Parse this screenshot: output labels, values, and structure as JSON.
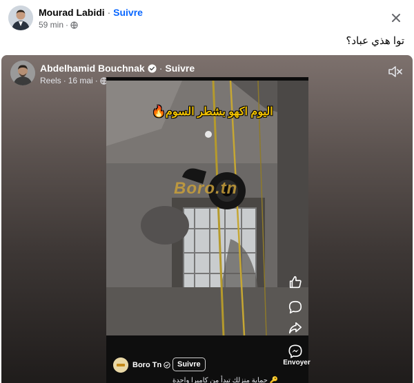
{
  "post": {
    "author": "Mourad Labidi",
    "separator": "·",
    "follow_label": "Suivre",
    "time": "59 min",
    "time_separator": "·",
    "privacy_icon": "globe-icon",
    "text": "توا هذي عباد؟",
    "close_icon": "close-icon"
  },
  "shared": {
    "author": "Abdelhamid Bouchnak",
    "verified_icon": "verified-badge-icon",
    "separator": "·",
    "follow_label": "Suivre",
    "source": "Reels",
    "source_separator": "·",
    "date": "16 mai",
    "date_separator": "·",
    "privacy_icon": "globe-icon",
    "mute_icon": "speaker-muted-icon"
  },
  "video": {
    "caption": "اليوم اكهو بشطر السوم🔥",
    "watermark": "Boro.tn",
    "channel_name": "Boro Tn",
    "channel_follow": "Suivre",
    "description": "🔑 حماية منزلك تبدأ من كاميرا واحدة",
    "send_label": "Envoyer"
  },
  "colors": {
    "link_blue": "#0866ff",
    "meta_gray": "#65676b",
    "caption_yellow": "#f2c200"
  }
}
